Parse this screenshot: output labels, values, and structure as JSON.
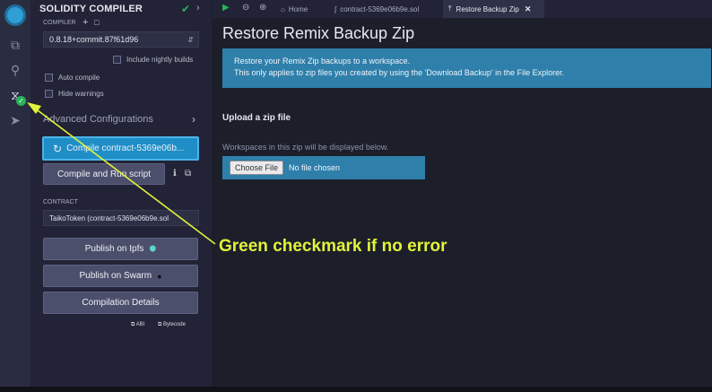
{
  "compiler_panel": {
    "title": "SOLIDITY COMPILER",
    "compiler_label": "COMPILER",
    "compiler_version": "0.8.18+commit.87f61d96",
    "nightly_label": "Include nightly builds",
    "auto_compile_label": "Auto compile",
    "hide_warnings_label": "Hide warnings",
    "advanced_label": "Advanced Configurations",
    "compile_button": "Compile contract-5369e06b...",
    "compile_run_button": "Compile and Run script",
    "contract_label": "CONTRACT",
    "contract_value": "TaikoToken (contract-5369e06b9e.sol",
    "publish_ipfs": "Publish on Ipfs",
    "publish_swarm": "Publish on Swarm",
    "compilation_details": "Compilation Details",
    "abi_link": "ABI",
    "bytecode_link": "Bytecode"
  },
  "tabs": {
    "home": "Home",
    "contract": "contract-5369e06b9e.sol",
    "restore": "Restore Backup Zip"
  },
  "main": {
    "title": "Restore Remix Backup Zip",
    "info_line1": "Restore your Remix Zip backups to a workspace.",
    "info_line2": "This only applies to zip files you created by using the 'Download Backup' in the File Explorer.",
    "upload_heading": "Upload a zip file",
    "workspaces_note": "Workspaces in this zip will be displayed below.",
    "choose_file": "Choose File",
    "no_file": "No file chosen"
  },
  "annotation": {
    "text": "Green checkmark if no error"
  },
  "colors": {
    "accent_blue": "#1f8ec7",
    "success_green": "#26b35a",
    "annotation_yellow": "#e2f23a"
  },
  "icons": [
    "remix-logo-icon",
    "file-explorer-icon",
    "search-icon",
    "solidity-compiler-icon",
    "deploy-run-icon",
    "play-icon",
    "zoom-out-icon",
    "zoom-in-icon",
    "home-icon",
    "solidity-file-icon",
    "upload-icon",
    "close-icon",
    "refresh-icon",
    "info-icon",
    "copy-icon",
    "ipfs-icon",
    "swarm-icon"
  ]
}
